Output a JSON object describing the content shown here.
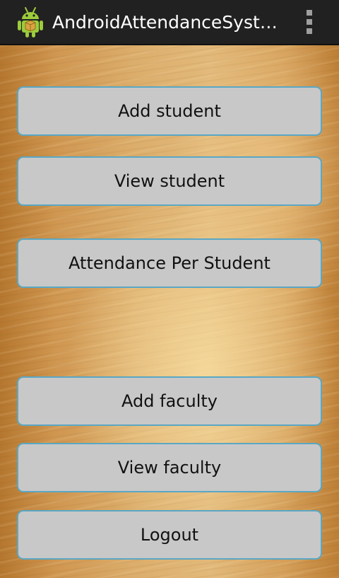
{
  "app_bar": {
    "title": "AndroidAttendanceSystem",
    "app_icon": "android-robot-icon",
    "menu_icon": "overflow-menu-icon",
    "background_color": "#212121"
  },
  "menu": {
    "button_color": "#c8c8c8",
    "button_border_color": "#5aa7c4",
    "add_student": "Add student",
    "view_student": "View student",
    "attendance_per_student": "Attendance Per Student",
    "add_faculty": "Add faculty",
    "view_faculty": "View faculty",
    "logout": "Logout"
  }
}
